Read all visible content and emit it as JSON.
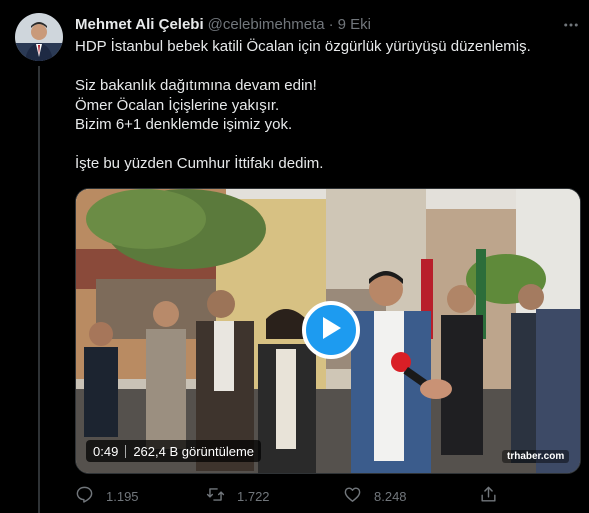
{
  "tweet": {
    "author_name": "Mehmet Ali Çelebi",
    "handle": "@celebimehmeta",
    "separator": "·",
    "time": "9 Eki",
    "text_lines": [
      "HDP İstanbul bebek katili Öcalan için özgürlük yürüyüşü düzenlemiş.",
      "",
      "Siz bakanlık dağıtımına devam edin!",
      "Ömer Öcalan İçişlerine yakışır.",
      "Bizim 6+1 denklemde işimiz yok.",
      "",
      "İşte bu yüzden Cumhur İttifakı dedim."
    ],
    "video": {
      "duration": "0:49",
      "views": "262,4 B görüntüleme",
      "watermark": "trhaber.com"
    },
    "actions": {
      "reply_count": "1.195",
      "retweet_count": "1.722",
      "like_count": "8.248"
    }
  },
  "colors": {
    "background": "#000000",
    "text_primary": "#e7e9ea",
    "text_secondary": "#71767b",
    "accent": "#1d9bf0",
    "divider": "#2f3336"
  },
  "icons": [
    "avatar",
    "more-icon",
    "play-icon",
    "reply-icon",
    "retweet-icon",
    "like-icon",
    "share-icon"
  ]
}
